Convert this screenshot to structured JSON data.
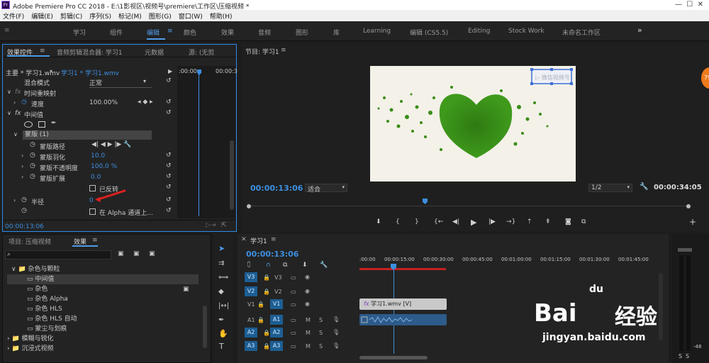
{
  "window": {
    "app_badge": "Pr",
    "title": "Adobe Premiere Pro CC 2018 - E:\\1影视区\\视频号\\premiere\\工作区\\压缩视频 *"
  },
  "menu": [
    "文件(F)",
    "编辑(E)",
    "剪辑(C)",
    "序列(S)",
    "标记(M)",
    "图形(G)",
    "窗口(W)",
    "帮助(H)"
  ],
  "workspaces": [
    "学习",
    "组件",
    "编辑",
    "颜色",
    "效果",
    "音频",
    "图形",
    "库",
    "Learning",
    "编辑 (CS5.5)",
    "Editing",
    "Stock Work",
    "未命名工作区"
  ],
  "workspace_more": "»",
  "effect_controls": {
    "tabs": [
      "效果控件",
      "音频剪辑混合器: 学习1",
      "元数据",
      "源: (无剪"
    ],
    "tab_menu_icon": "≡",
    "source_label": "主要 * 学习1.wmv",
    "clip_label": "学习1 * 学习1.wmv",
    "ruler_start": ":00:00",
    "ruler_end": "00:00:3",
    "blend_label": "混合模式",
    "blend_value": "正常",
    "time_remap": "时间重映射",
    "speed_label": "速度",
    "speed_value": "100.00%",
    "effect_name": "中间值",
    "mask_name": "蒙版 (1)",
    "mask_path": "蒙版路径",
    "mask_feather": "蒙版羽化",
    "mask_feather_value": "10.0",
    "mask_opacity": "蒙版不透明度",
    "mask_opacity_value": "100.0 %",
    "mask_expansion": "蒙版扩展",
    "mask_expansion_value": "0.0",
    "inverted": "已反转",
    "radius_label": "半径",
    "radius_value": "0",
    "alpha_label": "在 Alpha 通道上...",
    "timecode": "00:00:13:06"
  },
  "program": {
    "title": "节目: 学习1",
    "timecode": "00:00:13:06",
    "fit": "适合",
    "resolution": "1/2",
    "duration": "00:00:34:05",
    "watermark": "▷ 微信视频号",
    "badge": "79"
  },
  "project": {
    "tabs": [
      "项目: 压缩视频",
      "效果"
    ],
    "tab_menu_icon": "≡",
    "search_placeholder": "",
    "items": [
      {
        "label": "杂色与颗粒",
        "level": 1,
        "folder": true
      },
      {
        "label": "中间值",
        "level": 2,
        "selected": true
      },
      {
        "label": "杂色",
        "level": 2
      },
      {
        "label": "杂色 Alpha",
        "level": 2
      },
      {
        "label": "杂色 HLS",
        "level": 2
      },
      {
        "label": "杂色 HLS 自动",
        "level": 2
      },
      {
        "label": "蒙尘与划痕",
        "level": 2
      },
      {
        "label": "模糊与锐化",
        "level": 0,
        "folder": true
      },
      {
        "label": "沉浸式视频",
        "level": 0,
        "folder": true
      }
    ]
  },
  "timeline": {
    "title": "学习1",
    "tab_menu_icon": "≡",
    "timecode": "00:00:13:06",
    "ruler": [
      ":00:00",
      "00:00:15:00",
      "00:00:30:00",
      "00:00:45:00",
      "00:01:00:00",
      "00:01:15:00",
      "00:01:30:00",
      "00:01:45:00"
    ],
    "tracks": [
      {
        "target": "V3",
        "name": "V3"
      },
      {
        "target": "V2",
        "name": "V2"
      },
      {
        "target": "V1",
        "name": "V1",
        "src": "V1"
      },
      {
        "target": "A1",
        "name": "A1",
        "src": "A1"
      },
      {
        "target": "A2",
        "name": "A2"
      },
      {
        "target": "A3",
        "name": "A3"
      }
    ],
    "clip_label": "学习1.wmv [V]",
    "track_mute": "M",
    "track_solo": "S"
  },
  "meters": {
    "minus": "-48",
    "s_labels": [
      "S",
      "S"
    ]
  },
  "watermark": {
    "brand": "Bai",
    "brand2": "经验",
    "paw": "du",
    "url": "jingyan.baidu.com"
  },
  "colors": {
    "accent": "#4f9be8",
    "track": "#1d5e93",
    "playhead": "#3d8fe0",
    "clip": "#c9c9c9",
    "audio": "#2d5b8a"
  }
}
